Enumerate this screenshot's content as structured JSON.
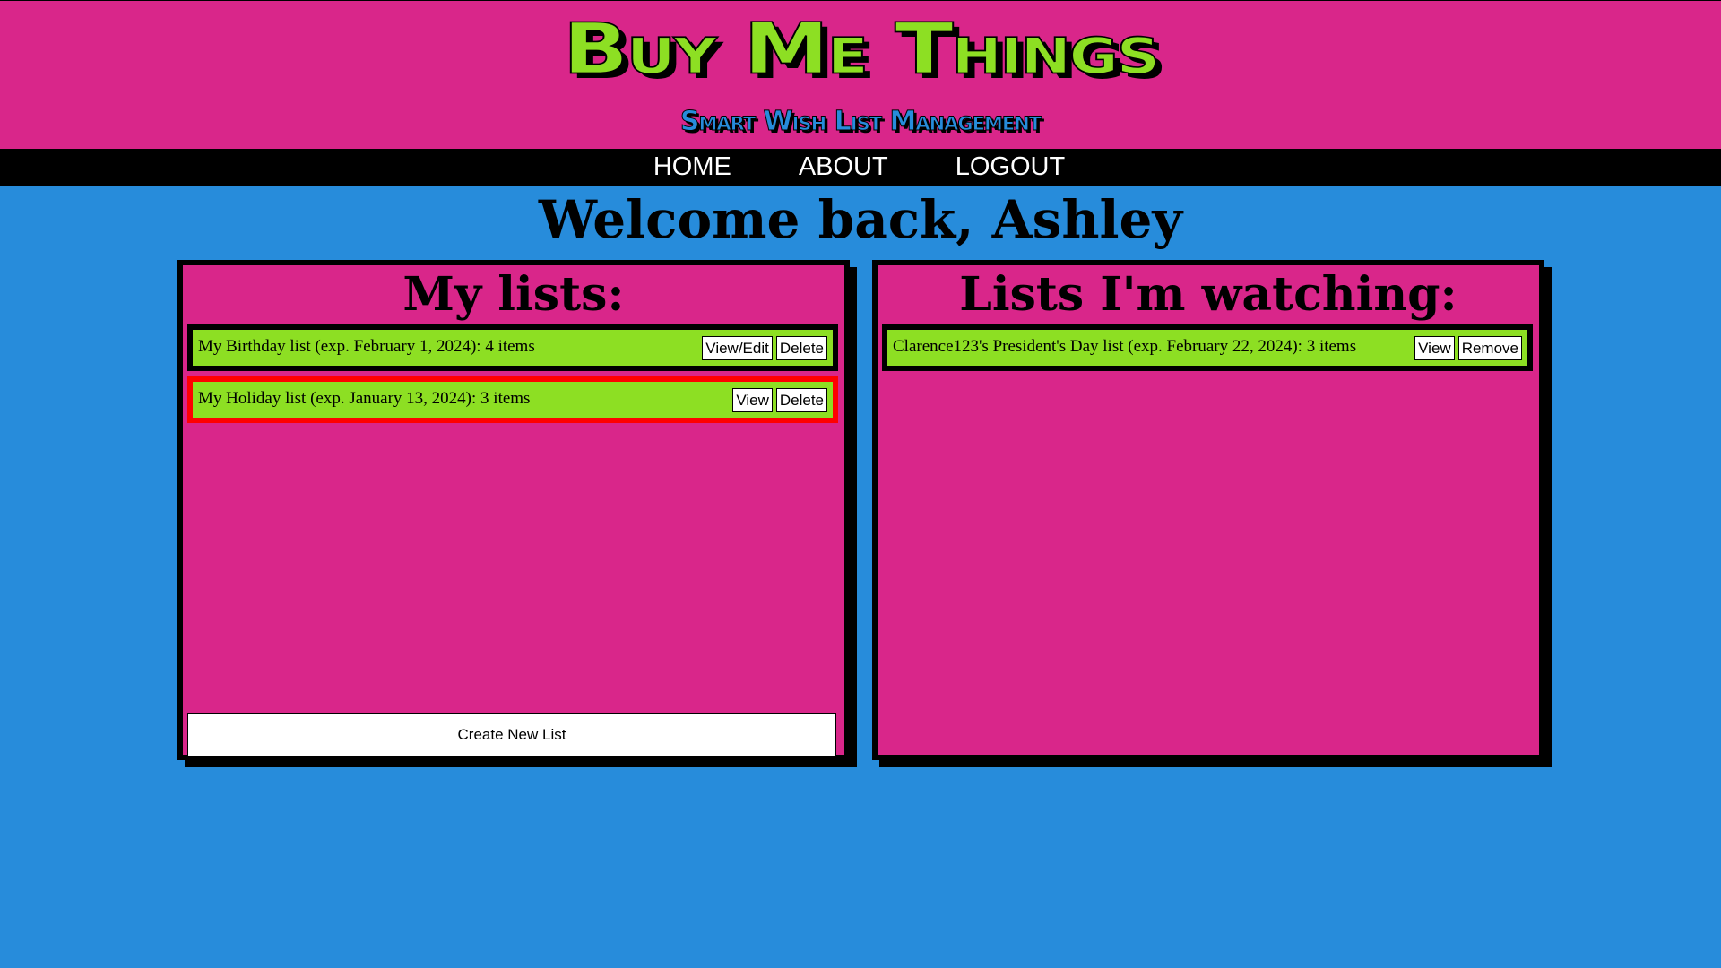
{
  "site": {
    "title": "Buy Me Things",
    "subtitle": "Smart Wish List Management"
  },
  "nav": {
    "items": [
      {
        "label": "HOME"
      },
      {
        "label": "ABOUT"
      },
      {
        "label": "LOGOUT"
      }
    ]
  },
  "welcome": "Welcome back, Ashley",
  "my_lists": {
    "heading": "My lists:",
    "items": [
      {
        "text": "My Birthday list (exp. February 1, 2024): 4 items",
        "primary_button": "View/Edit",
        "secondary_button": "Delete"
      },
      {
        "text": "My Holiday list (exp. January 13, 2024): 3 items",
        "primary_button": "View",
        "secondary_button": "Delete"
      }
    ],
    "create_button": "Create New List"
  },
  "watching": {
    "heading": "Lists I'm watching:",
    "items": [
      {
        "text": "Clarence123's President's Day list (exp. February 22, 2024): 3 items",
        "primary_button": "View",
        "secondary_button": "Remove"
      }
    ]
  },
  "colors": {
    "page_background": "#278cdb",
    "header_background": "#d9268a",
    "accent_green": "#8ddf23",
    "highlight_border": "#ff0000"
  }
}
